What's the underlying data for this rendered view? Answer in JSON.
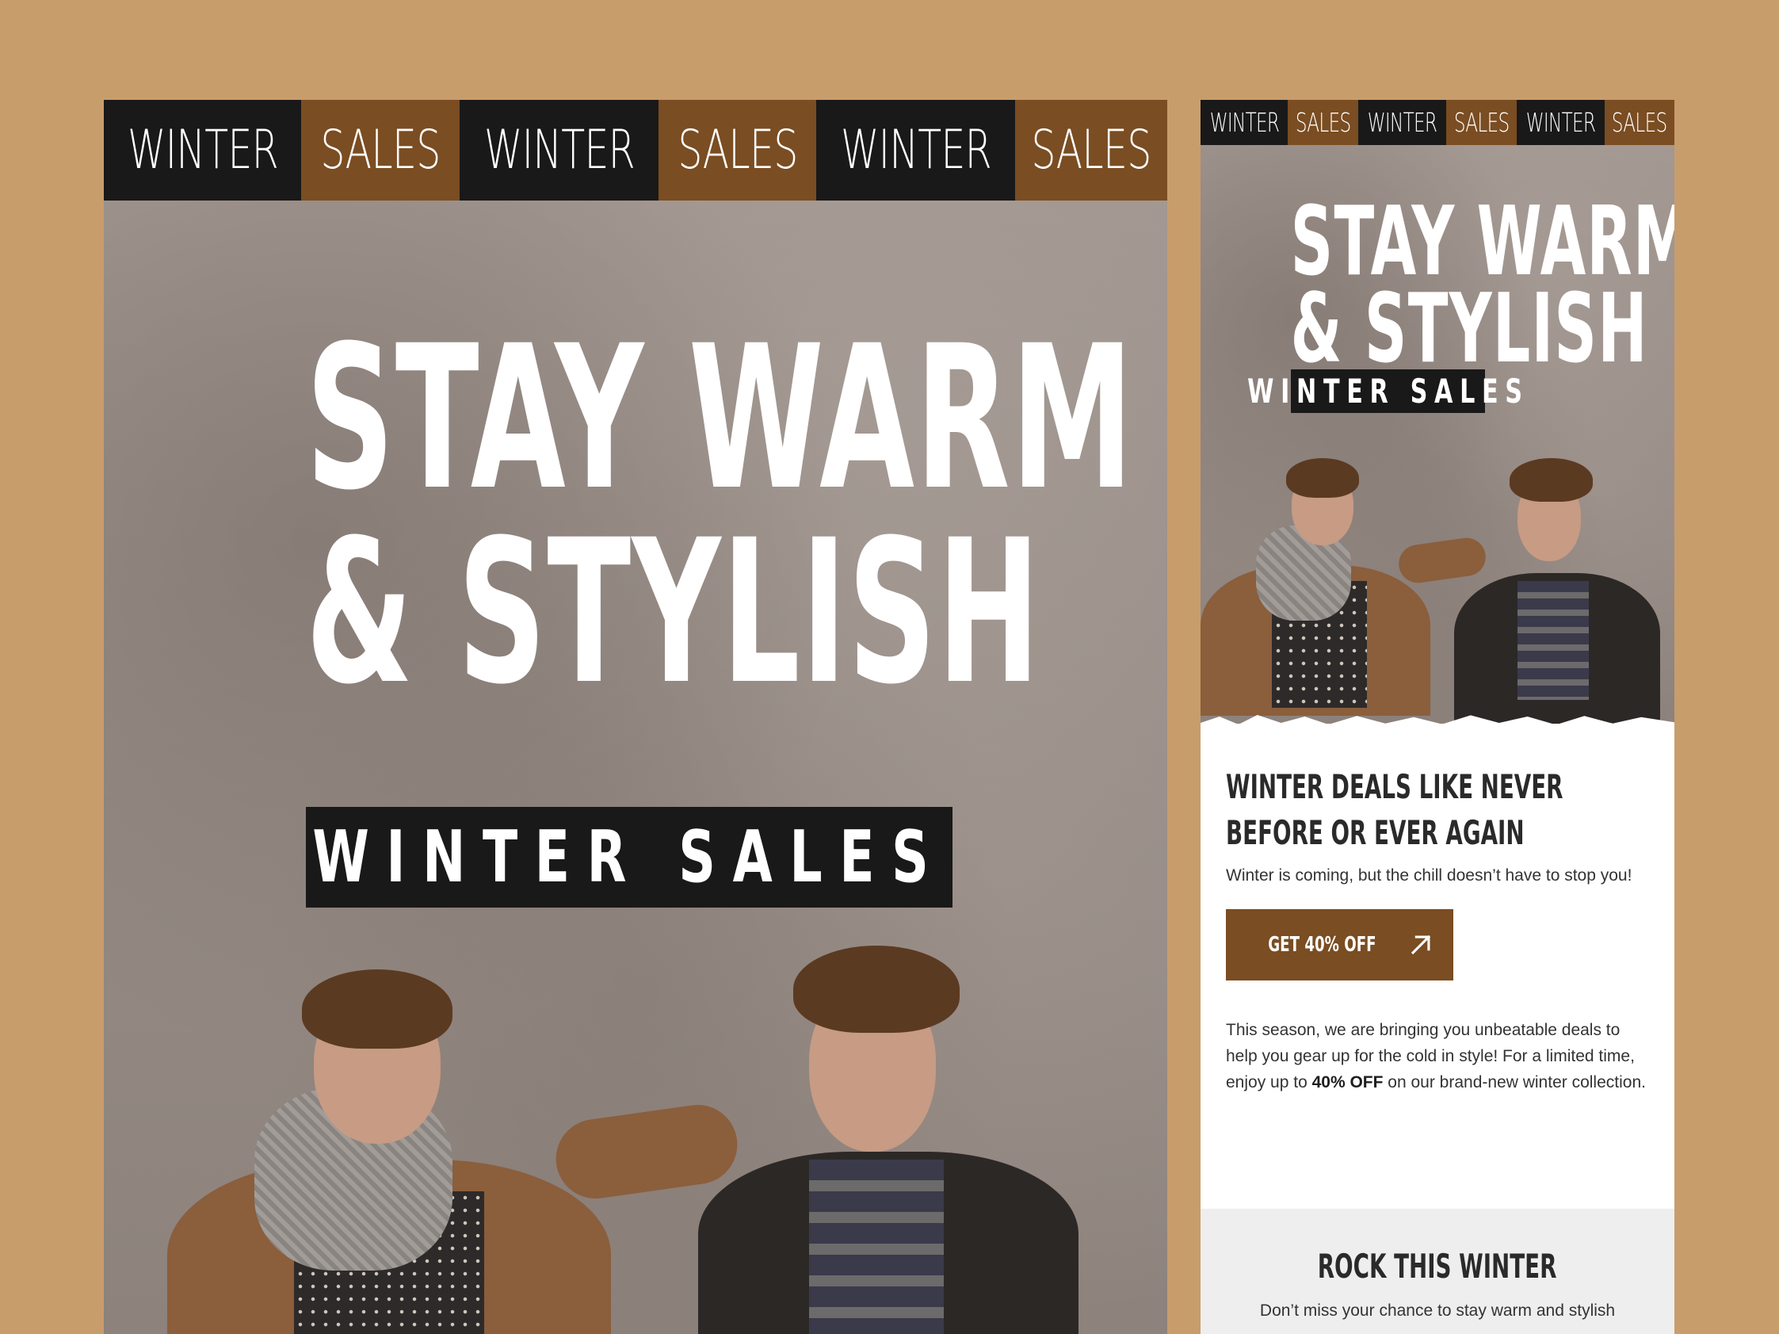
{
  "left_card": {
    "ticker": [
      "WINTER",
      "SALES",
      "WINTER",
      "SALES",
      "WINTER",
      "SALES"
    ],
    "title_line_1": "STAY WARM",
    "title_line_2": "& STYLISH",
    "badge": "WINTER SALES"
  },
  "right_card": {
    "ticker": [
      "WINTER",
      "SALES",
      "WINTER",
      "SALES",
      "WINTER",
      "SALES"
    ],
    "title_line_1": "STAY WARM",
    "title_line_2": "& STYLISH",
    "badge": "WINTER SALES",
    "deals_heading": "WINTER DEALS LIKE NEVER BEFORE OR EVER AGAIN",
    "deals_sub": "Winter is coming, but the chill doesn’t have to stop you!",
    "cta_label": "GET 40% OFF",
    "cta_icon": "arrow-up-right-icon",
    "body_copy": {
      "before": "This season, we are bringing you unbeatable deals to help you gear up for the cold in style! For a limited time, enjoy up to ",
      "bold": "40% OFF",
      "after": " on our brand-new winter collection."
    },
    "rock_heading": "ROCK THIS WINTER",
    "rock_text": "Don’t miss your chance to stay warm and stylish"
  },
  "colors": {
    "background": "#c89d6c",
    "dark": "#191919",
    "brown": "#7a4d22",
    "white": "#ffffff",
    "light_gray": "#eeeeee"
  }
}
